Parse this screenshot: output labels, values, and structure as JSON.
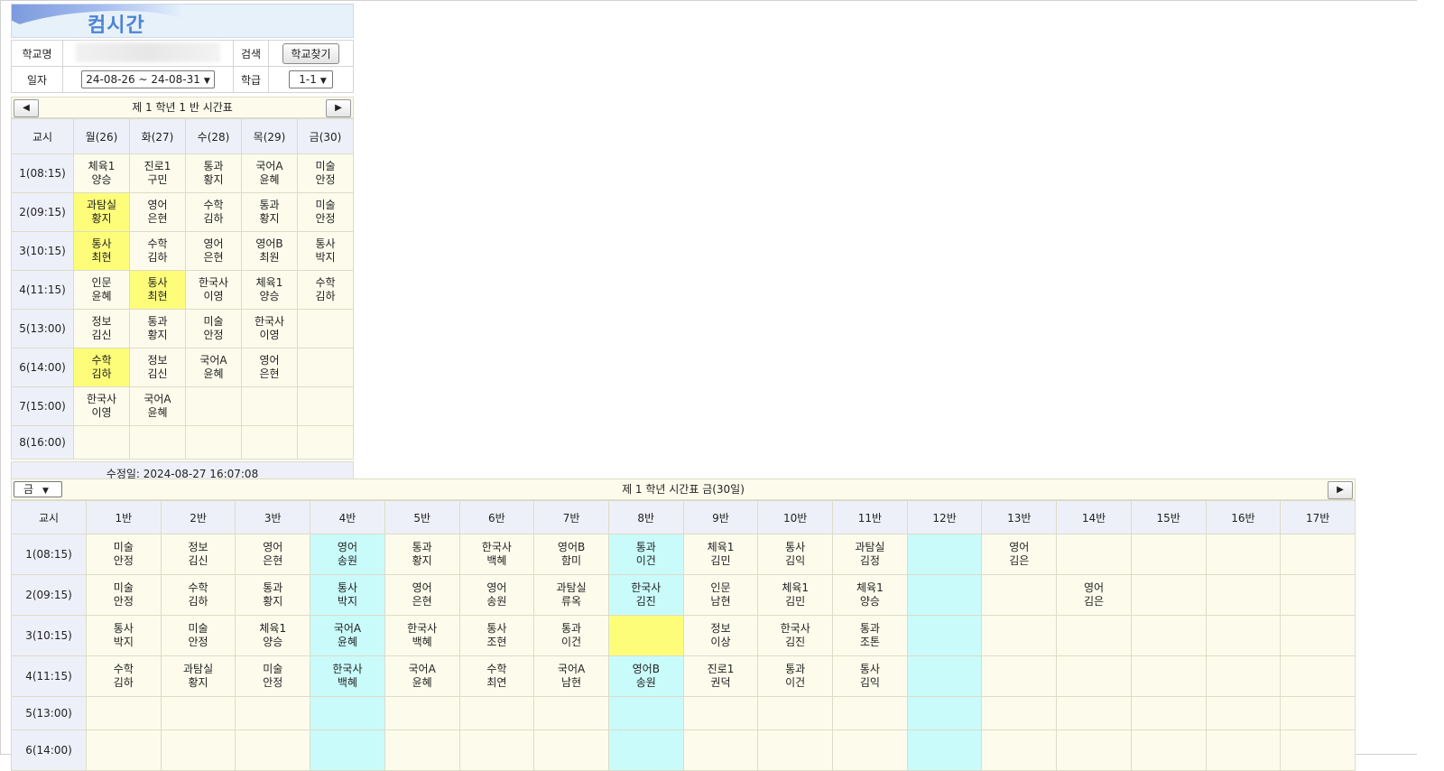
{
  "app": {
    "title": "컴시간"
  },
  "info": {
    "school_label": "학교명",
    "search_label": "검색",
    "find_button": "학교찾기",
    "date_label": "일자",
    "date_value": "24-08-26 ~ 24-08-31",
    "class_label": "학급",
    "class_value": "1-1"
  },
  "weekly": {
    "title": "제 1 학년 1 반 시간표",
    "headers": [
      "교시",
      "월(26)",
      "화(27)",
      "수(28)",
      "목(29)",
      "금(30)"
    ],
    "rows": [
      {
        "period": "1(08:15)",
        "cells": [
          [
            "체육1",
            "양승"
          ],
          [
            "진로1",
            "구민"
          ],
          [
            "통과",
            "황지"
          ],
          [
            "국어A",
            "윤혜"
          ],
          [
            "미술",
            "안정"
          ]
        ]
      },
      {
        "period": "2(09:15)",
        "cells": [
          [
            "과탐실",
            "황지"
          ],
          [
            "영어",
            "은현"
          ],
          [
            "수학",
            "김하"
          ],
          [
            "통과",
            "황지"
          ],
          [
            "미술",
            "안정"
          ]
        ]
      },
      {
        "period": "3(10:15)",
        "cells": [
          [
            "통사",
            "최현"
          ],
          [
            "수학",
            "김하"
          ],
          [
            "영어",
            "은현"
          ],
          [
            "영어B",
            "최원"
          ],
          [
            "통사",
            "박지"
          ]
        ]
      },
      {
        "period": "4(11:15)",
        "cells": [
          [
            "인문",
            "윤혜"
          ],
          [
            "통사",
            "최현"
          ],
          [
            "한국사",
            "이영"
          ],
          [
            "체육1",
            "양승"
          ],
          [
            "수학",
            "김하"
          ]
        ]
      },
      {
        "period": "5(13:00)",
        "cells": [
          [
            "정보",
            "김신"
          ],
          [
            "통과",
            "황지"
          ],
          [
            "미술",
            "안정"
          ],
          [
            "한국사",
            "이영"
          ],
          [
            "",
            ""
          ]
        ]
      },
      {
        "period": "6(14:00)",
        "cells": [
          [
            "수학",
            "김하"
          ],
          [
            "정보",
            "김신"
          ],
          [
            "국어A",
            "윤혜"
          ],
          [
            "영어",
            "은현"
          ],
          [
            "",
            ""
          ]
        ]
      },
      {
        "period": "7(15:00)",
        "cells": [
          [
            "한국사",
            "이영"
          ],
          [
            "국어A",
            "윤혜"
          ],
          [
            "",
            ""
          ],
          [
            "",
            ""
          ],
          [
            "",
            ""
          ]
        ]
      },
      {
        "period": "8(16:00)",
        "cells": [
          [
            "",
            ""
          ],
          [
            "",
            ""
          ],
          [
            "",
            ""
          ],
          [
            "",
            ""
          ],
          [
            "",
            ""
          ]
        ]
      }
    ],
    "modified": "수정일: 2024-08-27 16:07:08"
  },
  "daily": {
    "day_select": "금",
    "title": "제 1 학년 시간표 금(30일)",
    "headers": [
      "교시",
      "1반",
      "2반",
      "3반",
      "4반",
      "5반",
      "6반",
      "7반",
      "8반",
      "9반",
      "10반",
      "11반",
      "12반",
      "13반",
      "14반",
      "15반",
      "16반",
      "17반"
    ],
    "rows": [
      {
        "period": "1(08:15)",
        "cells": [
          [
            "미술",
            "안정"
          ],
          [
            "정보",
            "김신"
          ],
          [
            "영어",
            "은현"
          ],
          [
            "영어",
            "송원"
          ],
          [
            "통과",
            "황지"
          ],
          [
            "한국사",
            "백혜"
          ],
          [
            "영어B",
            "함미"
          ],
          [
            "통과",
            "이건"
          ],
          [
            "체육1",
            "김민"
          ],
          [
            "통사",
            "김익"
          ],
          [
            "과탐실",
            "김정"
          ],
          [
            "",
            ""
          ],
          [
            "영어",
            "김은"
          ],
          [
            "",
            ""
          ],
          [
            "",
            ""
          ],
          [
            "",
            ""
          ],
          [
            "",
            ""
          ]
        ]
      },
      {
        "period": "2(09:15)",
        "cells": [
          [
            "미술",
            "안정"
          ],
          [
            "수학",
            "김하"
          ],
          [
            "통과",
            "황지"
          ],
          [
            "통사",
            "박지"
          ],
          [
            "영어",
            "은현"
          ],
          [
            "영어",
            "송원"
          ],
          [
            "과탐실",
            "류옥"
          ],
          [
            "한국사",
            "김진"
          ],
          [
            "인문",
            "남현"
          ],
          [
            "체육1",
            "김민"
          ],
          [
            "체육1",
            "양승"
          ],
          [
            "",
            ""
          ],
          [
            "",
            ""
          ],
          [
            "영어",
            "김은"
          ],
          [
            "",
            ""
          ],
          [
            "",
            ""
          ],
          [
            "",
            ""
          ]
        ]
      },
      {
        "period": "3(10:15)",
        "cells": [
          [
            "통사",
            "박지"
          ],
          [
            "미술",
            "안정"
          ],
          [
            "체육1",
            "양승"
          ],
          [
            "국어A",
            "윤혜"
          ],
          [
            "한국사",
            "백혜"
          ],
          [
            "통사",
            "조현"
          ],
          [
            "통과",
            "이건"
          ],
          [
            "",
            ""
          ],
          [
            "정보",
            "이상"
          ],
          [
            "한국사",
            "김진"
          ],
          [
            "통과",
            "조톤"
          ],
          [
            "",
            ""
          ],
          [
            "",
            ""
          ],
          [
            "",
            ""
          ],
          [
            "",
            ""
          ],
          [
            "",
            ""
          ],
          [
            "",
            ""
          ]
        ]
      },
      {
        "period": "4(11:15)",
        "cells": [
          [
            "수학",
            "김하"
          ],
          [
            "과탐실",
            "황지"
          ],
          [
            "미술",
            "안정"
          ],
          [
            "한국사",
            "백혜"
          ],
          [
            "국어A",
            "윤혜"
          ],
          [
            "수학",
            "최연"
          ],
          [
            "국어A",
            "남현"
          ],
          [
            "영어B",
            "송원"
          ],
          [
            "진로1",
            "권덕"
          ],
          [
            "통과",
            "이건"
          ],
          [
            "통사",
            "김익"
          ],
          [
            "",
            ""
          ],
          [
            "",
            ""
          ],
          [
            "",
            ""
          ],
          [
            "",
            ""
          ],
          [
            "",
            ""
          ],
          [
            "",
            ""
          ]
        ]
      },
      {
        "period": "5(13:00)",
        "cells": [
          [
            "",
            ""
          ],
          [
            "",
            ""
          ],
          [
            "",
            ""
          ],
          [
            "",
            ""
          ],
          [
            "",
            ""
          ],
          [
            "",
            ""
          ],
          [
            "",
            ""
          ],
          [
            "",
            ""
          ],
          [
            "",
            ""
          ],
          [
            "",
            ""
          ],
          [
            "",
            ""
          ],
          [
            "",
            ""
          ],
          [
            "",
            ""
          ],
          [
            "",
            ""
          ],
          [
            "",
            ""
          ],
          [
            "",
            ""
          ],
          [
            "",
            ""
          ]
        ]
      },
      {
        "period": "6(14:00)",
        "cells": [
          [
            "",
            ""
          ],
          [
            "",
            ""
          ],
          [
            "",
            ""
          ],
          [
            "",
            ""
          ],
          [
            "",
            ""
          ],
          [
            "",
            ""
          ],
          [
            "",
            ""
          ],
          [
            "",
            ""
          ],
          [
            "",
            ""
          ],
          [
            "",
            ""
          ],
          [
            "",
            ""
          ],
          [
            "",
            ""
          ],
          [
            "",
            ""
          ],
          [
            "",
            ""
          ],
          [
            "",
            ""
          ],
          [
            "",
            ""
          ],
          [
            "",
            ""
          ]
        ]
      }
    ]
  }
}
